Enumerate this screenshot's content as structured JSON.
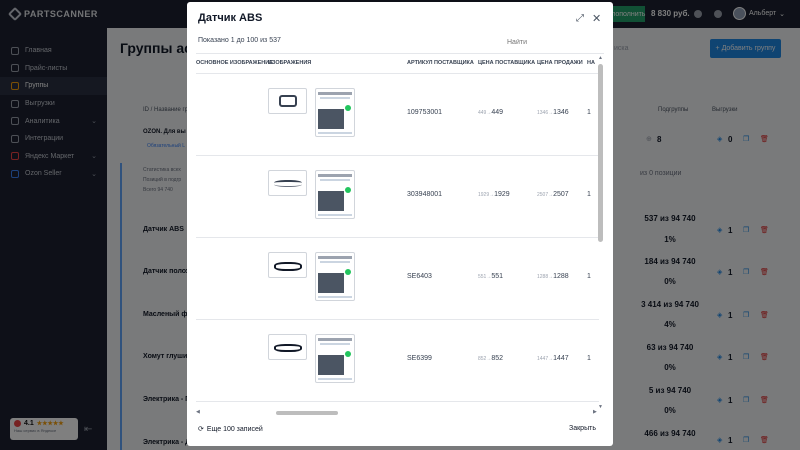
{
  "app": {
    "logo_text": "PARTSCANNER",
    "balance": "8 830 руб.",
    "topup_label": "пополнить",
    "user_name": "Альберт"
  },
  "sidebar": {
    "items": [
      {
        "label": "Главная",
        "icon": "gauge-icon"
      },
      {
        "label": "Прайс-листы",
        "icon": "pricelist-icon"
      },
      {
        "label": "Группы",
        "icon": "groups-icon",
        "active": true
      },
      {
        "label": "Выгрузки",
        "icon": "export-icon"
      },
      {
        "label": "Аналитика",
        "icon": "chart-icon",
        "expandable": true
      },
      {
        "label": "Интеграции",
        "icon": "integration-icon"
      },
      {
        "label": "Яндекс Маркет",
        "icon": "yandex-icon",
        "expandable": true
      },
      {
        "label": "Ozon Seller",
        "icon": "ozon-icon",
        "expandable": true
      }
    ],
    "rating": {
      "value": "4.1",
      "sub": "Наш сервис в Яндексе"
    }
  },
  "background": {
    "page_title": "Группы ас",
    "search_placeholder": "иска",
    "add_group_label": "Добавить группу",
    "col_name": "ID / Название группы",
    "col_subgroups": "Подгруппы",
    "col_exports": "Выгрузки",
    "ozon_group": "OZON. Для вы",
    "ozon_link": "Обязательный L",
    "subgroup_count": "8",
    "export_count": "0",
    "stats_line1": "Статистика всех",
    "stats_line2": "Позиций в подгр",
    "stats_line3": "Всего 94 740",
    "stats_right": "из 0 позиции",
    "rows": [
      {
        "name": "Датчик ABS",
        "found": "537 из 94 740",
        "pct": "1%",
        "subgroups": "1",
        "exports": "0"
      },
      {
        "name": "Датчик полож",
        "found": "184 из 94 740",
        "pct": "0%",
        "subgroups": "1",
        "exports": "0"
      },
      {
        "name": "Масленый фил",
        "found": "3 414 из 94 740",
        "pct": "4%",
        "subgroups": "1",
        "exports": "0"
      },
      {
        "name": "Хомут глушите",
        "found": "63 из 94 740",
        "pct": "0%",
        "subgroups": "1",
        "exports": "0"
      },
      {
        "name": "Электрика - Га",
        "found": "5 из 94 740",
        "pct": "0%",
        "subgroups": "1",
        "exports": "0"
      },
      {
        "name": "Электрика - Д",
        "found": "466 из 94 740",
        "pct": "",
        "subgroups": "1",
        "exports": "0"
      }
    ]
  },
  "modal": {
    "title": "Датчик ABS",
    "shown_text": "Показано 1 до 100 из 537",
    "search_placeholder": "Найти",
    "columns": {
      "main_image": "ОСНОВНОЕ ИЗОБРАЖЕНИЕ",
      "images": "ИЗОБРАЖЕНИЯ",
      "supplier_sku": "АРТИКУЛ ПОСТАВЩИКА",
      "supplier_price": "ЦЕНА ПОСТАВЩИКА",
      "sale_price": "ЦЕНА ПРОДАЖИ",
      "qty": "НА"
    },
    "rows": [
      {
        "sku": "109753001",
        "supplier_old": "449",
        "supplier_new": "449",
        "sale_old": "1346",
        "sale_new": "1346",
        "qty": "1"
      },
      {
        "sku": "303948001",
        "supplier_old": "1929",
        "supplier_new": "1929",
        "sale_old": "2507",
        "sale_new": "2507",
        "qty": "1"
      },
      {
        "sku": "SE6403",
        "supplier_old": "551",
        "supplier_new": "551",
        "sale_old": "1288",
        "sale_new": "1288",
        "qty": "1"
      },
      {
        "sku": "SE6399",
        "supplier_old": "852",
        "supplier_new": "852",
        "sale_old": "1447",
        "sale_new": "1447",
        "qty": "1"
      }
    ],
    "more_label": "Еще 100 записей",
    "close_label": "Закрыть"
  }
}
